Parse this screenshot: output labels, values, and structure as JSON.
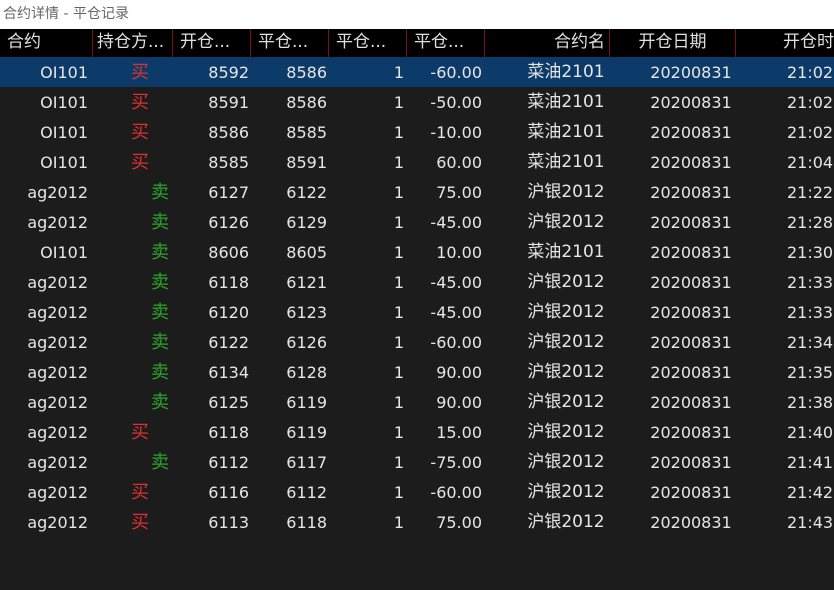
{
  "window": {
    "title": "合约详情 - 平仓记录"
  },
  "header": {
    "columns": [
      "合约",
      "持仓方...",
      "开仓...",
      "平仓...",
      "平仓...",
      "平仓...",
      "合约名",
      "开仓日期",
      "开仓时"
    ]
  },
  "colors": {
    "buy": "#e03030",
    "sell": "#2aa52a",
    "selected_row": "#0c3a69",
    "header_divider": "#7a1010"
  },
  "rows": [
    [
      "OI101",
      "买",
      "8592",
      "8586",
      "1",
      "-60.00",
      "菜油2101",
      "20200831",
      "21:02:"
    ],
    [
      "OI101",
      "买",
      "8591",
      "8586",
      "1",
      "-50.00",
      "菜油2101",
      "20200831",
      "21:02:"
    ],
    [
      "OI101",
      "买",
      "8586",
      "8585",
      "1",
      "-10.00",
      "菜油2101",
      "20200831",
      "21:02:"
    ],
    [
      "OI101",
      "买",
      "8585",
      "8591",
      "1",
      "60.00",
      "菜油2101",
      "20200831",
      "21:04:"
    ],
    [
      "ag2012",
      "卖",
      "6127",
      "6122",
      "1",
      "75.00",
      "沪银2012",
      "20200831",
      "21:22:"
    ],
    [
      "ag2012",
      "卖",
      "6126",
      "6129",
      "1",
      "-45.00",
      "沪银2012",
      "20200831",
      "21:28:"
    ],
    [
      "OI101",
      "卖",
      "8606",
      "8605",
      "1",
      "10.00",
      "菜油2101",
      "20200831",
      "21:30:"
    ],
    [
      "ag2012",
      "卖",
      "6118",
      "6121",
      "1",
      "-45.00",
      "沪银2012",
      "20200831",
      "21:33:"
    ],
    [
      "ag2012",
      "卖",
      "6120",
      "6123",
      "1",
      "-45.00",
      "沪银2012",
      "20200831",
      "21:33:"
    ],
    [
      "ag2012",
      "卖",
      "6122",
      "6126",
      "1",
      "-60.00",
      "沪银2012",
      "20200831",
      "21:34:"
    ],
    [
      "ag2012",
      "卖",
      "6134",
      "6128",
      "1",
      "90.00",
      "沪银2012",
      "20200831",
      "21:35:"
    ],
    [
      "ag2012",
      "卖",
      "6125",
      "6119",
      "1",
      "90.00",
      "沪银2012",
      "20200831",
      "21:38:"
    ],
    [
      "ag2012",
      "买",
      "6118",
      "6119",
      "1",
      "15.00",
      "沪银2012",
      "20200831",
      "21:40:"
    ],
    [
      "ag2012",
      "卖",
      "6112",
      "6117",
      "1",
      "-75.00",
      "沪银2012",
      "20200831",
      "21:41:"
    ],
    [
      "ag2012",
      "买",
      "6116",
      "6112",
      "1",
      "-60.00",
      "沪银2012",
      "20200831",
      "21:42:"
    ],
    [
      "ag2012",
      "买",
      "6113",
      "6118",
      "1",
      "75.00",
      "沪银2012",
      "20200831",
      "21:43:"
    ]
  ]
}
